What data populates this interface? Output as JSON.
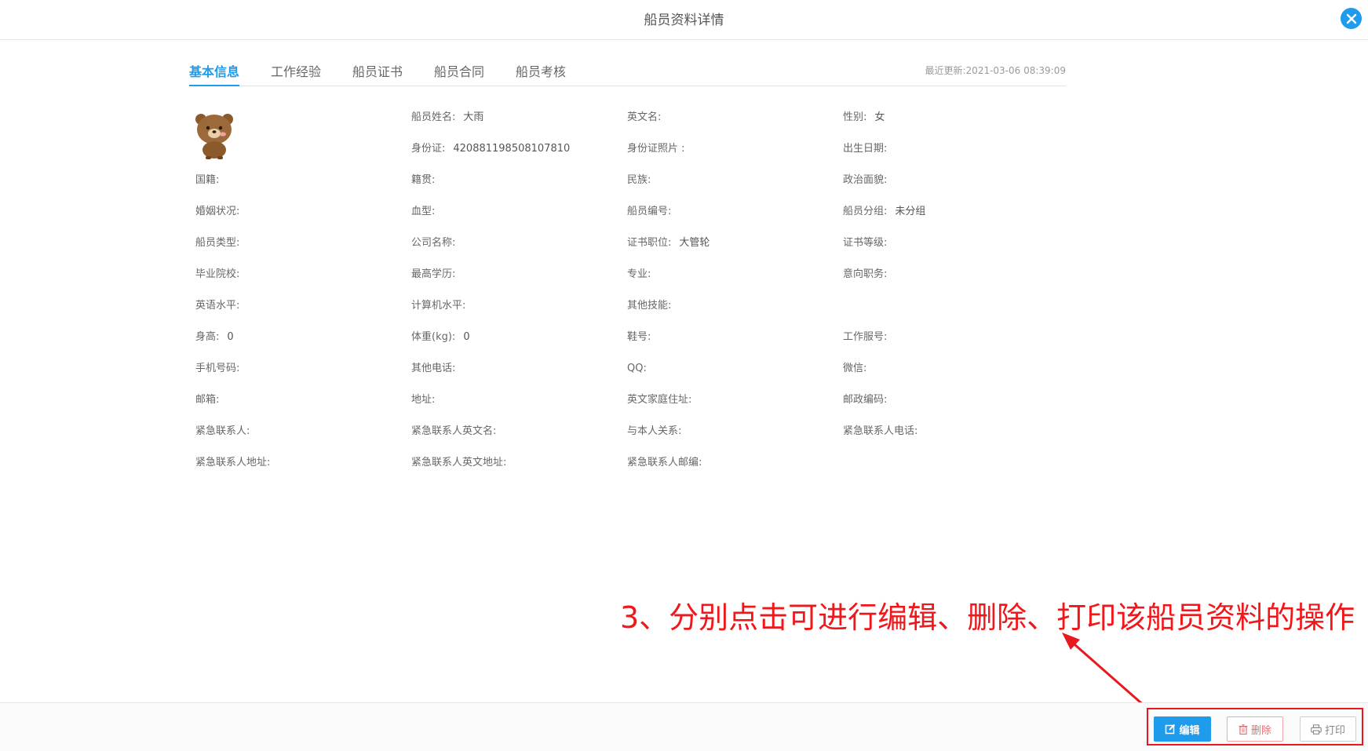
{
  "header": {
    "title": "船员资料详情"
  },
  "tabs": [
    {
      "label": "基本信息",
      "active": true
    },
    {
      "label": "工作经验",
      "active": false
    },
    {
      "label": "船员证书",
      "active": false
    },
    {
      "label": "船员合同",
      "active": false
    },
    {
      "label": "船员考核",
      "active": false
    }
  ],
  "last_updated": "最近更新:2021-03-06 08:39:09",
  "fields": {
    "name": {
      "label": "船员姓名:",
      "value": "大雨"
    },
    "english_name": {
      "label": "英文名:",
      "value": ""
    },
    "gender": {
      "label": "性别:",
      "value": "女"
    },
    "id_card": {
      "label": "身份证:",
      "value": "420881198508107810"
    },
    "id_photo": {
      "label": "身份证照片 :",
      "value": ""
    },
    "birth_date": {
      "label": "出生日期:",
      "value": ""
    },
    "nationality": {
      "label": "国籍:",
      "value": ""
    },
    "native_place": {
      "label": "籍贯:",
      "value": ""
    },
    "ethnicity": {
      "label": "民族:",
      "value": ""
    },
    "political_status": {
      "label": "政治面貌:",
      "value": ""
    },
    "marital_status": {
      "label": "婚姻状况:",
      "value": ""
    },
    "blood_type": {
      "label": "血型:",
      "value": ""
    },
    "crew_number": {
      "label": "船员编号:",
      "value": ""
    },
    "crew_group": {
      "label": "船员分组:",
      "value": "未分组"
    },
    "crew_type": {
      "label": "船员类型:",
      "value": ""
    },
    "company_name": {
      "label": "公司名称:",
      "value": ""
    },
    "cert_position": {
      "label": "证书职位:",
      "value": "大管轮"
    },
    "cert_level": {
      "label": "证书等级:",
      "value": ""
    },
    "school": {
      "label": "毕业院校:",
      "value": ""
    },
    "education": {
      "label": "最高学历:",
      "value": ""
    },
    "major": {
      "label": "专业:",
      "value": ""
    },
    "desired_position": {
      "label": "意向职务:",
      "value": ""
    },
    "english_level": {
      "label": "英语水平:",
      "value": ""
    },
    "computer_level": {
      "label": "计算机水平:",
      "value": ""
    },
    "other_skills": {
      "label": "其他技能:",
      "value": ""
    },
    "height": {
      "label": "身高:",
      "value": "0"
    },
    "weight": {
      "label": "体重(kg):",
      "value": "0"
    },
    "shoe_size": {
      "label": "鞋号:",
      "value": ""
    },
    "uniform_size": {
      "label": "工作服号:",
      "value": ""
    },
    "mobile": {
      "label": "手机号码:",
      "value": ""
    },
    "other_phone": {
      "label": "其他电话:",
      "value": ""
    },
    "qq": {
      "label": "QQ:",
      "value": ""
    },
    "wechat": {
      "label": "微信:",
      "value": ""
    },
    "email": {
      "label": "邮箱:",
      "value": ""
    },
    "address": {
      "label": "地址:",
      "value": ""
    },
    "english_home_address": {
      "label": "英文家庭住址:",
      "value": ""
    },
    "postal_code": {
      "label": "邮政编码:",
      "value": ""
    },
    "emergency_contact": {
      "label": "紧急联系人:",
      "value": ""
    },
    "emergency_contact_en_name": {
      "label": "紧急联系人英文名:",
      "value": ""
    },
    "relationship": {
      "label": "与本人关系:",
      "value": ""
    },
    "emergency_phone": {
      "label": "紧急联系人电话:",
      "value": ""
    },
    "emergency_address": {
      "label": "紧急联系人地址:",
      "value": ""
    },
    "emergency_en_address": {
      "label": "紧急联系人英文地址:",
      "value": ""
    },
    "emergency_postcode": {
      "label": "紧急联系人邮编:",
      "value": ""
    }
  },
  "annotation": "3、分别点击可进行编辑、删除、打印该船员资料的操作",
  "actions": {
    "edit": "编辑",
    "delete": "删除",
    "print": "打印"
  },
  "colors": {
    "accent": "#1e9bea",
    "annotation": "#f0171b",
    "delete": "#f06a6a"
  }
}
